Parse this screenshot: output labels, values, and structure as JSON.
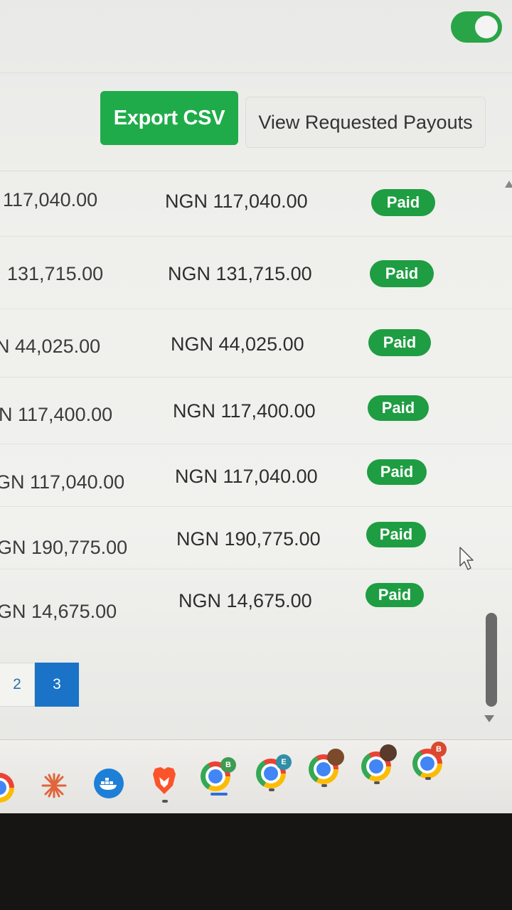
{
  "toolbar": {
    "export_label": "Export CSV",
    "view_payouts_label": "View Requested Payouts"
  },
  "table": {
    "rows": [
      {
        "amount": "117,040.00",
        "ngn": "NGN 117,040.00",
        "status": "Paid"
      },
      {
        "amount": "131,715.00",
        "ngn": "NGN 131,715.00",
        "status": "Paid"
      },
      {
        "amount": "44,025.00",
        "ngn": "NGN 44,025.00",
        "status": "Paid"
      },
      {
        "amount": "N 117,400.00",
        "ngn": "NGN 117,400.00",
        "status": "Paid"
      },
      {
        "amount": "GN 117,040.00",
        "ngn": "NGN 117,040.00",
        "status": "Paid"
      },
      {
        "amount": "GN 190,775.00",
        "ngn": "NGN 190,775.00",
        "status": "Paid"
      },
      {
        "amount": "GN 14,675.00",
        "ngn": "NGN 14,675.00",
        "status": "Paid"
      }
    ]
  },
  "pagination": {
    "pages": [
      "2",
      "3"
    ],
    "current": "3"
  },
  "taskbar": {
    "icons": [
      "chrome-icon",
      "claude-icon",
      "docker-icon",
      "brave-icon",
      "chrome-profile-b-icon",
      "chrome-profile-e-icon",
      "chrome-profile-photo-icon",
      "chrome-profile-photo2-icon",
      "chrome-profile-b2-icon"
    ],
    "badge_b": "B",
    "badge_e": "E",
    "badge_b2": "B"
  },
  "colors": {
    "accent_green": "#20ab4a",
    "paid_badge": "#1e9d42",
    "page_active": "#1a73c7"
  }
}
